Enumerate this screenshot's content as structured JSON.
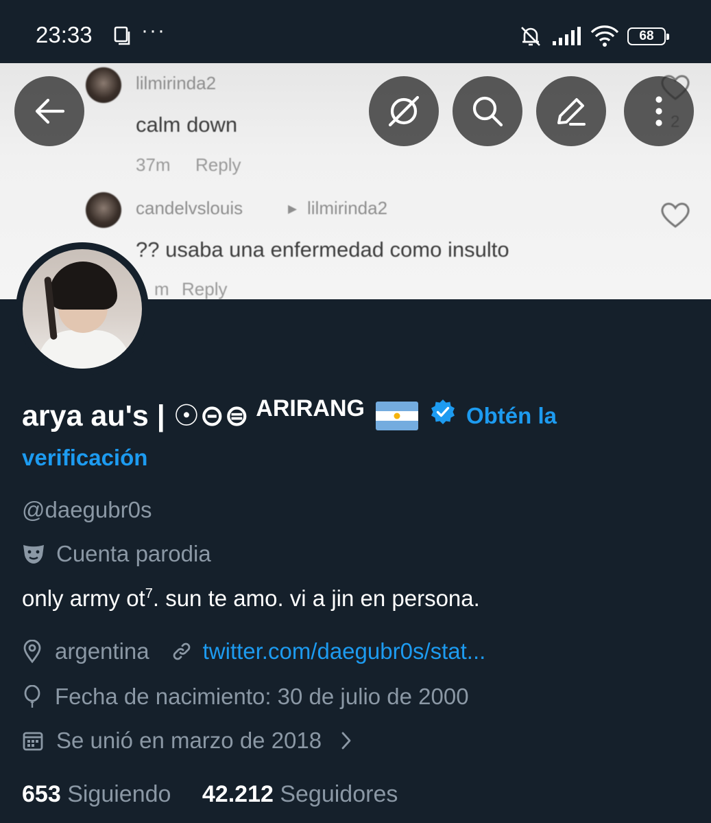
{
  "status_bar": {
    "time": "23:33",
    "more": "···",
    "battery": "68"
  },
  "banner_comments": [
    {
      "user": "lilmirinda2",
      "text": "calm down",
      "time": "37m",
      "reply": "Reply",
      "likes": "2"
    },
    {
      "user": "candelvslouis",
      "reply_to": "lilmirinda2",
      "text": "?? usaba una enfermedad como insulto",
      "time": "m",
      "reply": "Reply"
    }
  ],
  "profile": {
    "name": "arya au's | ☉⊝⊜",
    "name_sup": "ARIRANG",
    "get_verified_1": "Obtén la",
    "get_verified_2": "verificación",
    "handle": "@daegubr0s",
    "parody_label": "Cuenta parodia",
    "bio_main": "only army ot",
    "bio_sup": "7",
    "bio_rest": ". sun te amo.  vi a jin en persona.",
    "location": "argentina",
    "link": "twitter.com/daegubr0s/stat...",
    "birthday": "Fecha de nacimiento: 30 de julio de 2000",
    "joined": "Se unió en marzo de 2018",
    "following_count": "653",
    "following_label": "Siguiendo",
    "followers_count": "42.212",
    "followers_label": "Seguidores"
  },
  "colors": {
    "background": "#15202b",
    "accent": "#1d9bf0",
    "secondary_text": "#8b98a5"
  }
}
